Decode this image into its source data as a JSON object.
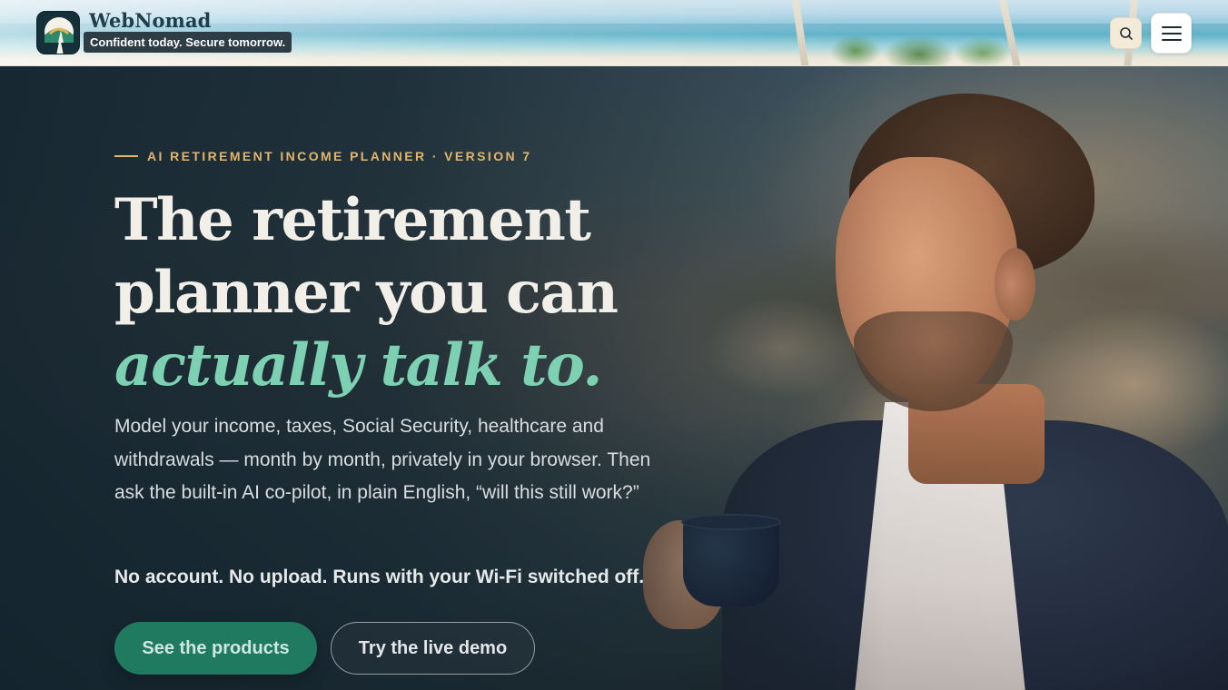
{
  "header": {
    "brand_name": "WebNomad",
    "tagline": "Confident today. Secure tomorrow.",
    "search_icon": "search-icon",
    "menu_icon": "hamburger-menu-icon"
  },
  "hero": {
    "eyebrow": "AI RETIREMENT INCOME PLANNER · VERSION 7",
    "headline_line1": "The retirement",
    "headline_line2": "planner you can",
    "headline_accent": "actually talk to.",
    "subtitle": "Model your income, taxes, Social Security, healthcare and withdrawals — month by month, privately in your browser. Then ask the built-in AI co-pilot, in plain English, “will this still work?”",
    "privacy_note": "No account. No upload. Runs with your Wi-Fi switched off.",
    "primary_cta": "See the products",
    "secondary_cta": "Try the live demo"
  },
  "colors": {
    "accent_teal": "#7ed0b3",
    "eyebrow_gold": "#e3b56a",
    "cta_green": "#1f7a60",
    "brand_dark": "#1e3e4d"
  }
}
